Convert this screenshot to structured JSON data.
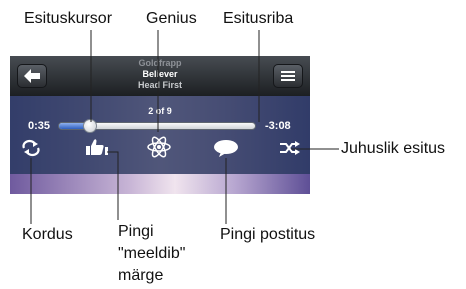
{
  "callouts": {
    "scrubber": "Esituskursor",
    "genius": "Genius",
    "scrub_bar": "Esitusriba",
    "shuffle": "Juhuslik esitus",
    "repeat": "Kordus",
    "ping_like_lines": [
      "Pingi",
      "\"meeldib\"",
      "märge"
    ],
    "ping_post": "Pingi postitus"
  },
  "now_playing": {
    "artist": "Goldfrapp",
    "song": "Believer",
    "album": "Head First",
    "track_counter": "2 of 9",
    "elapsed": "0:35",
    "remaining": "-3:08",
    "progress_fraction": 0.16
  },
  "icons": {
    "back": "back-arrow-icon",
    "track_list": "track-list-icon",
    "repeat": "repeat-icon",
    "like": "thumbs-up-icon",
    "genius": "genius-atom-icon",
    "post": "speech-bubble-icon",
    "shuffle": "shuffle-icon"
  },
  "colors": {
    "progress_fill": "#2f5fc0",
    "callout_line": "#222222",
    "icon": "#ffffff"
  }
}
